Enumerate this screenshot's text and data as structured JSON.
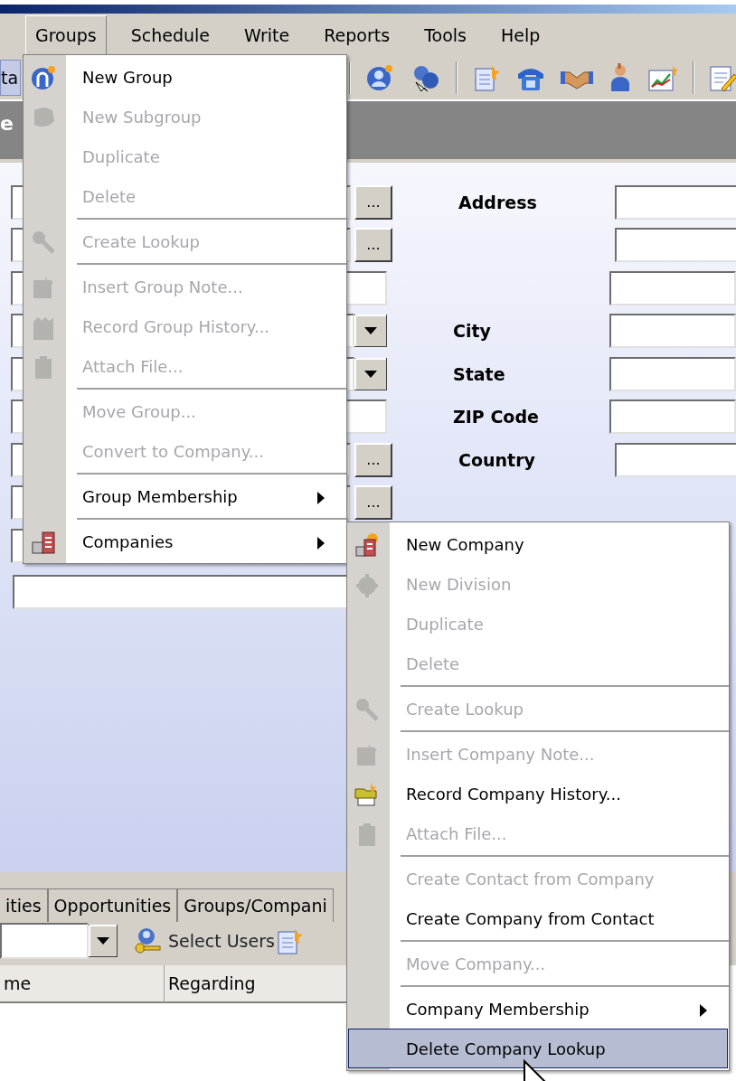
{
  "menubar": [
    {
      "label": "Groups",
      "selected": true
    },
    {
      "label": "Schedule",
      "selected": false
    },
    {
      "label": "Write",
      "selected": false
    },
    {
      "label": "Reports",
      "selected": false
    },
    {
      "label": "Tools",
      "selected": false
    },
    {
      "label": "Help",
      "selected": false
    }
  ],
  "toolbar": {
    "field_text": "ta"
  },
  "section_header": "e",
  "form": {
    "left_rows": [
      {
        "kind": "lookup",
        "button_text": "..."
      },
      {
        "kind": "lookup",
        "button_text": "..."
      },
      {
        "kind": "plain"
      },
      {
        "kind": "dropdown"
      },
      {
        "kind": "dropdown"
      },
      {
        "kind": "plain"
      },
      {
        "kind": "lookup",
        "button_text": "..."
      },
      {
        "kind": "lookup",
        "button_text": "..."
      },
      {
        "kind": "plain"
      }
    ],
    "right_rows": [
      {
        "label": "Address"
      },
      {},
      {},
      {
        "label": "City"
      },
      {
        "label": "State"
      },
      {
        "label": "ZIP Code"
      },
      {
        "label": "Country"
      }
    ]
  },
  "tabs": [
    {
      "label": "ities",
      "selected": false
    },
    {
      "label": "Opportunities",
      "selected": false
    },
    {
      "label": "Groups/Compani",
      "selected": false
    }
  ],
  "list_toolbar": {
    "select_users": "Select Users"
  },
  "columns": [
    "me",
    "Regarding"
  ],
  "groups_menu": {
    "items": [
      {
        "kind": "item",
        "label": "New Group",
        "disabled": false,
        "submenu": false,
        "selected": false
      },
      {
        "kind": "item",
        "label": "New Subgroup",
        "disabled": true,
        "submenu": false,
        "selected": false
      },
      {
        "kind": "item",
        "label": "Duplicate",
        "disabled": true,
        "submenu": false,
        "selected": false
      },
      {
        "kind": "item",
        "label": "Delete",
        "disabled": true,
        "submenu": false,
        "selected": false
      },
      {
        "kind": "separator"
      },
      {
        "kind": "item",
        "label": "Create Lookup",
        "disabled": true,
        "submenu": false,
        "selected": false
      },
      {
        "kind": "separator"
      },
      {
        "kind": "item",
        "label": "Insert Group Note...",
        "disabled": true,
        "submenu": false,
        "selected": false
      },
      {
        "kind": "item",
        "label": "Record Group History...",
        "disabled": true,
        "submenu": false,
        "selected": false
      },
      {
        "kind": "item",
        "label": "Attach File...",
        "disabled": true,
        "submenu": false,
        "selected": false
      },
      {
        "kind": "separator"
      },
      {
        "kind": "item",
        "label": "Move Group...",
        "disabled": true,
        "submenu": false,
        "selected": false
      },
      {
        "kind": "item",
        "label": "Convert to Company...",
        "disabled": true,
        "submenu": false,
        "selected": false
      },
      {
        "kind": "separator"
      },
      {
        "kind": "item",
        "label": "Group Membership",
        "disabled": false,
        "submenu": true,
        "selected": false
      },
      {
        "kind": "separator"
      },
      {
        "kind": "item",
        "label": "Companies",
        "disabled": false,
        "submenu": true,
        "selected": false
      }
    ]
  },
  "companies_menu": {
    "items": [
      {
        "kind": "item",
        "label": "New Company",
        "disabled": false,
        "submenu": false,
        "selected": false
      },
      {
        "kind": "item",
        "label": "New Division",
        "disabled": true,
        "submenu": false,
        "selected": false
      },
      {
        "kind": "item",
        "label": "Duplicate",
        "disabled": true,
        "submenu": false,
        "selected": false
      },
      {
        "kind": "item",
        "label": "Delete",
        "disabled": true,
        "submenu": false,
        "selected": false
      },
      {
        "kind": "separator"
      },
      {
        "kind": "item",
        "label": "Create Lookup",
        "disabled": true,
        "submenu": false,
        "selected": false
      },
      {
        "kind": "separator"
      },
      {
        "kind": "item",
        "label": "Insert Company Note...",
        "disabled": true,
        "submenu": false,
        "selected": false
      },
      {
        "kind": "item",
        "label": "Record Company History...",
        "disabled": false,
        "submenu": false,
        "selected": false
      },
      {
        "kind": "item",
        "label": "Attach File...",
        "disabled": true,
        "submenu": false,
        "selected": false
      },
      {
        "kind": "separator"
      },
      {
        "kind": "item",
        "label": "Create Contact from Company",
        "disabled": true,
        "submenu": false,
        "selected": false
      },
      {
        "kind": "item",
        "label": "Create Company from Contact",
        "disabled": false,
        "submenu": false,
        "selected": false
      },
      {
        "kind": "separator"
      },
      {
        "kind": "item",
        "label": "Move Company...",
        "disabled": true,
        "submenu": false,
        "selected": false
      },
      {
        "kind": "separator"
      },
      {
        "kind": "item",
        "label": "Company Membership",
        "disabled": false,
        "submenu": true,
        "selected": false
      },
      {
        "kind": "item",
        "label": "Delete Company Lookup",
        "disabled": false,
        "submenu": false,
        "selected": true
      }
    ]
  }
}
